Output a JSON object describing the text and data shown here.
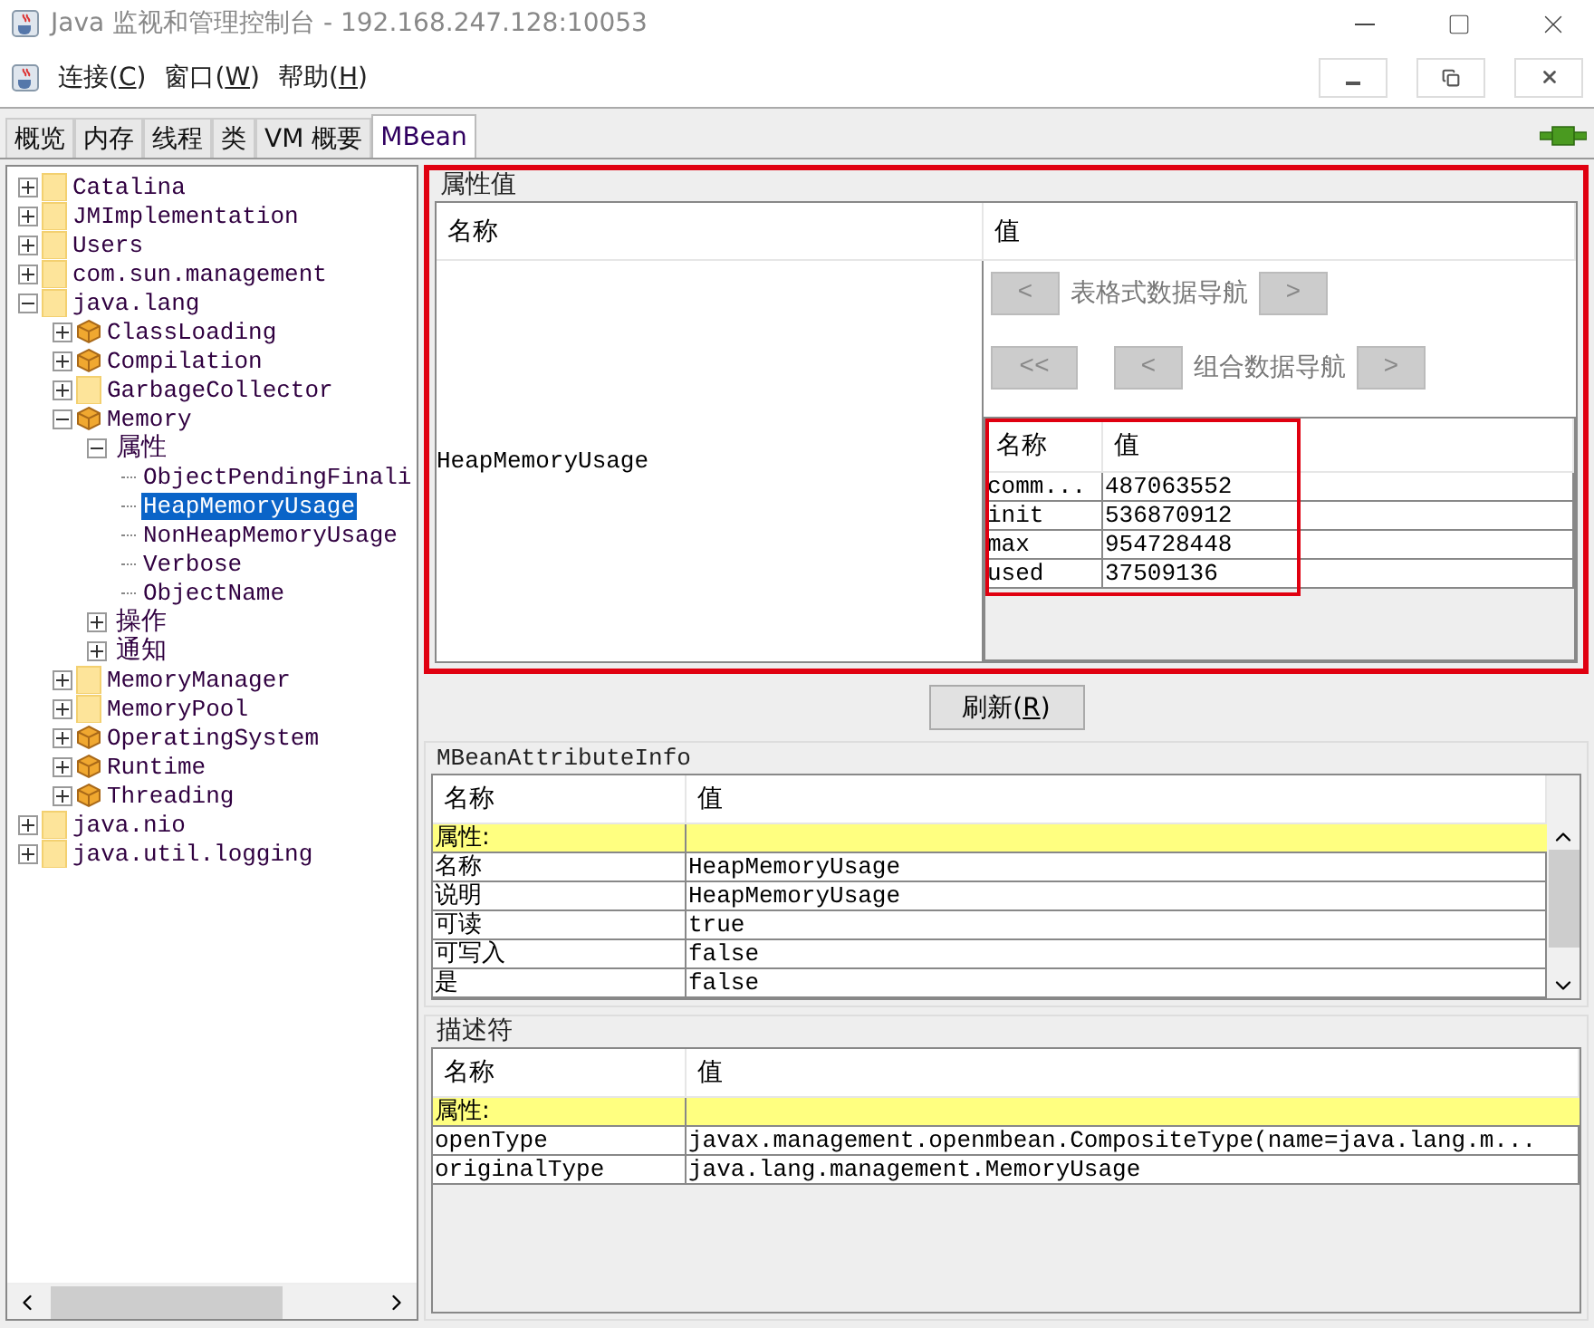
{
  "window": {
    "title": "Java 监视和管理控制台 - 192.168.247.128:10053"
  },
  "menu": [
    {
      "before": "连接(",
      "key": "C",
      "after": ")"
    },
    {
      "before": "窗口(",
      "key": "W",
      "after": ")"
    },
    {
      "before": "帮助(",
      "key": "H",
      "after": ")"
    }
  ],
  "tabs": [
    {
      "label": "概览",
      "selected": false
    },
    {
      "label": "内存",
      "selected": false
    },
    {
      "label": "线程",
      "selected": false
    },
    {
      "label": "类",
      "selected": false
    },
    {
      "label": "VM 概要",
      "selected": false
    },
    {
      "label": "MBean",
      "selected": true
    }
  ],
  "tree": [
    {
      "label": "Catalina",
      "kind": "folder",
      "expanded": false,
      "selected": false
    },
    {
      "label": "JMImplementation",
      "kind": "folder",
      "expanded": false,
      "selected": false
    },
    {
      "label": "Users",
      "kind": "folder",
      "expanded": false,
      "selected": false
    },
    {
      "label": "com.sun.management",
      "kind": "folder",
      "expanded": false,
      "selected": false
    },
    {
      "label": "java.lang",
      "kind": "folder",
      "expanded": true,
      "selected": false,
      "children": [
        {
          "label": "ClassLoading",
          "kind": "bean",
          "expanded": false,
          "selected": false
        },
        {
          "label": "Compilation",
          "kind": "bean",
          "expanded": false,
          "selected": false
        },
        {
          "label": "GarbageCollector",
          "kind": "folder",
          "expanded": false,
          "selected": false
        },
        {
          "label": "Memory",
          "kind": "bean",
          "expanded": true,
          "selected": false,
          "children": [
            {
              "label": "属性",
              "kind": "category",
              "expanded": true,
              "selected": false,
              "children": [
                {
                  "label": "ObjectPendingFinali",
                  "kind": "leaf",
                  "selected": false
                },
                {
                  "label": "HeapMemoryUsage",
                  "kind": "leaf",
                  "selected": true
                },
                {
                  "label": "NonHeapMemoryUsage",
                  "kind": "leaf",
                  "selected": false
                },
                {
                  "label": "Verbose",
                  "kind": "leaf",
                  "selected": false
                },
                {
                  "label": "ObjectName",
                  "kind": "leaf",
                  "selected": false
                }
              ]
            },
            {
              "label": "操作",
              "kind": "category",
              "expanded": false,
              "selected": false
            },
            {
              "label": "通知",
              "kind": "category",
              "expanded": false,
              "selected": false
            }
          ]
        },
        {
          "label": "MemoryManager",
          "kind": "folder",
          "expanded": false,
          "selected": false
        },
        {
          "label": "MemoryPool",
          "kind": "folder",
          "expanded": false,
          "selected": false
        },
        {
          "label": "OperatingSystem",
          "kind": "bean",
          "expanded": false,
          "selected": false
        },
        {
          "label": "Runtime",
          "kind": "bean",
          "expanded": false,
          "selected": false
        },
        {
          "label": "Threading",
          "kind": "bean",
          "expanded": false,
          "selected": false
        }
      ]
    },
    {
      "label": "java.nio",
      "kind": "folder",
      "expanded": false,
      "selected": false
    },
    {
      "label": "java.util.logging",
      "kind": "folder",
      "expanded": false,
      "selected": false
    }
  ],
  "attribute_values": {
    "title": "属性值",
    "columns": [
      "名称",
      "值"
    ],
    "name": "HeapMemoryUsage",
    "tabular_nav": {
      "label": "表格式数据导航",
      "buttons": [
        {
          "label": "<",
          "disabled": true
        },
        {
          "label": ">",
          "disabled": true
        }
      ]
    },
    "composite_nav": {
      "label": "组合数据导航",
      "buttons": [
        {
          "label": "<<",
          "disabled": true
        },
        {
          "label": "<",
          "disabled": true
        },
        {
          "label": ">",
          "disabled": true
        }
      ]
    },
    "composite": {
      "columns": [
        "名称",
        "值"
      ],
      "rows": [
        {
          "name": "comm...",
          "value": "487063552"
        },
        {
          "name": "init",
          "value": "536870912"
        },
        {
          "name": "max",
          "value": "954728448"
        },
        {
          "name": "used",
          "value": "37509136"
        }
      ]
    }
  },
  "refresh": {
    "before": "刷新(",
    "key": "R",
    "after": ")"
  },
  "attribute_info": {
    "title": "MBeanAttributeInfo",
    "columns": [
      "名称",
      "值"
    ],
    "rows": [
      {
        "kind": "section",
        "name": "属性:"
      },
      {
        "kind": "entry",
        "name": "名称",
        "value": "HeapMemoryUsage"
      },
      {
        "kind": "entry",
        "name": "说明",
        "value": "HeapMemoryUsage"
      },
      {
        "kind": "entry",
        "name": "可读",
        "value": "true"
      },
      {
        "kind": "entry",
        "name": "可写入",
        "value": "false"
      },
      {
        "kind": "entry",
        "name": "是",
        "value": "false"
      }
    ]
  },
  "descriptor": {
    "title": "描述符",
    "columns": [
      "名称",
      "值"
    ],
    "rows": [
      {
        "kind": "section",
        "name": "属性:"
      },
      {
        "kind": "entry",
        "name": "openType",
        "value": "javax.management.openmbean.CompositeType(name=java.lang.m..."
      },
      {
        "kind": "entry",
        "name": "originalType",
        "value": "java.lang.management.MemoryUsage"
      }
    ]
  }
}
